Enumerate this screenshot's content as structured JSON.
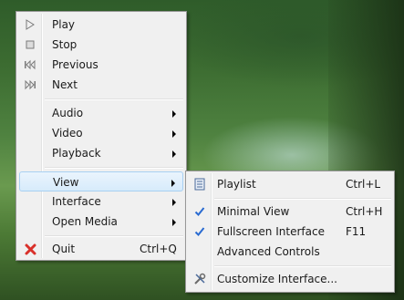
{
  "main_menu": {
    "items": [
      {
        "label": "Play",
        "icon": "play-icon"
      },
      {
        "label": "Stop",
        "icon": "stop-icon"
      },
      {
        "label": "Previous",
        "icon": "previous-icon"
      },
      {
        "label": "Next",
        "icon": "next-icon"
      },
      {
        "label": "Audio"
      },
      {
        "label": "Video"
      },
      {
        "label": "Playback"
      },
      {
        "label": "View",
        "highlighted": true
      },
      {
        "label": "Interface"
      },
      {
        "label": "Open Media"
      },
      {
        "label": "Quit",
        "shortcut": "Ctrl+Q",
        "icon": "close-icon"
      }
    ]
  },
  "view_submenu": {
    "items": [
      {
        "label": "Playlist",
        "shortcut": "Ctrl+L",
        "icon": "playlist-icon"
      },
      {
        "label": "Minimal View",
        "shortcut": "Ctrl+H",
        "checked": true
      },
      {
        "label": "Fullscreen Interface",
        "shortcut": "F11",
        "checked": true
      },
      {
        "label": "Advanced Controls"
      },
      {
        "label": "Customize Interface...",
        "icon": "tools-icon"
      }
    ]
  },
  "colors": {
    "highlight": "#d7ebfb",
    "check": "#2a6bd1",
    "quit_x": "#d9302a"
  }
}
